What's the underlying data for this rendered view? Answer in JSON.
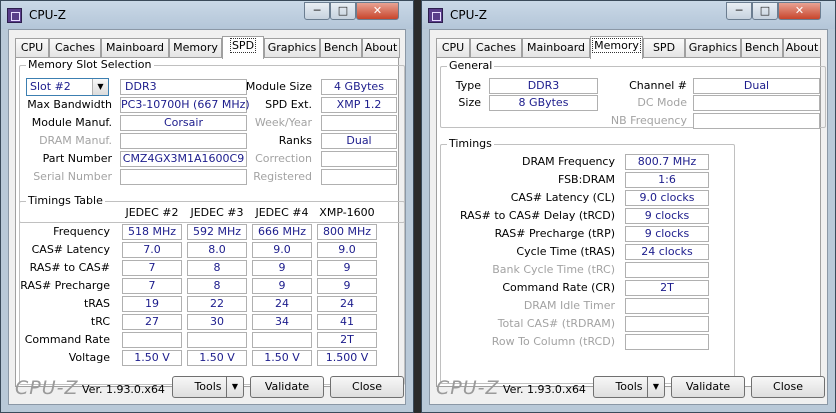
{
  "left": {
    "title": "CPU-Z",
    "tabs": [
      "CPU",
      "Caches",
      "Mainboard",
      "Memory",
      "SPD",
      "Graphics",
      "Bench",
      "About"
    ],
    "active_tab": "SPD",
    "slot_group": "Memory Slot Selection",
    "slot": "Slot #2",
    "type": "DDR3",
    "labels": {
      "max_bw": "Max Bandwidth",
      "manuf": "Module Manuf.",
      "dram_manuf": "DRAM Manuf.",
      "part": "Part Number",
      "serial": "Serial Number",
      "size": "Module Size",
      "spd_ext": "SPD Ext.",
      "week_year": "Week/Year",
      "ranks": "Ranks",
      "correction": "Correction",
      "registered": "Registered"
    },
    "values": {
      "max_bw": "PC3-10700H (667 MHz)",
      "manuf": "Corsair",
      "dram_manuf": "",
      "part": "CMZ4GX3M1A1600C9",
      "serial": "",
      "size": "4 GBytes",
      "spd_ext": "XMP 1.2",
      "week_year": "",
      "ranks": "Dual",
      "correction": "",
      "registered": ""
    },
    "timings_group": "Timings Table",
    "timing_columns": [
      "JEDEC #2",
      "JEDEC #3",
      "JEDEC #4",
      "XMP-1600"
    ],
    "timing_rows": [
      {
        "label": "Frequency",
        "values": [
          "518 MHz",
          "592 MHz",
          "666 MHz",
          "800 MHz"
        ]
      },
      {
        "label": "CAS# Latency",
        "values": [
          "7.0",
          "8.0",
          "9.0",
          "9.0"
        ]
      },
      {
        "label": "RAS# to CAS#",
        "values": [
          "7",
          "8",
          "9",
          "9"
        ]
      },
      {
        "label": "RAS# Precharge",
        "values": [
          "7",
          "8",
          "9",
          "9"
        ]
      },
      {
        "label": "tRAS",
        "values": [
          "19",
          "22",
          "24",
          "24"
        ]
      },
      {
        "label": "tRC",
        "values": [
          "27",
          "30",
          "34",
          "41"
        ]
      },
      {
        "label": "Command Rate",
        "values": [
          "",
          "",
          "",
          "2T"
        ]
      },
      {
        "label": "Voltage",
        "values": [
          "1.50 V",
          "1.50 V",
          "1.50 V",
          "1.500 V"
        ]
      }
    ]
  },
  "right": {
    "title": "CPU-Z",
    "tabs": [
      "CPU",
      "Caches",
      "Mainboard",
      "Memory",
      "SPD",
      "Graphics",
      "Bench",
      "About"
    ],
    "active_tab": "Memory",
    "general_group": "General",
    "labels": {
      "type": "Type",
      "size": "Size",
      "channel": "Channel #",
      "dc_mode": "DC Mode",
      "nb_freq": "NB Frequency"
    },
    "values": {
      "type": "DDR3",
      "size": "8 GBytes",
      "channel": "Dual",
      "dc_mode": "",
      "nb_freq": ""
    },
    "timings_group": "Timings",
    "timing_rows": [
      {
        "label": "DRAM Frequency",
        "value": "800.7 MHz",
        "enabled": true
      },
      {
        "label": "FSB:DRAM",
        "value": "1:6",
        "enabled": true
      },
      {
        "label": "CAS# Latency (CL)",
        "value": "9.0 clocks",
        "enabled": true
      },
      {
        "label": "RAS# to CAS# Delay (tRCD)",
        "value": "9 clocks",
        "enabled": true
      },
      {
        "label": "RAS# Precharge (tRP)",
        "value": "9 clocks",
        "enabled": true
      },
      {
        "label": "Cycle Time (tRAS)",
        "value": "24 clocks",
        "enabled": true
      },
      {
        "label": "Bank Cycle Time (tRC)",
        "value": "",
        "enabled": false
      },
      {
        "label": "Command Rate (CR)",
        "value": "2T",
        "enabled": true
      },
      {
        "label": "DRAM Idle Timer",
        "value": "",
        "enabled": false
      },
      {
        "label": "Total CAS# (tRDRAM)",
        "value": "",
        "enabled": false
      },
      {
        "label": "Row To Column (tRCD)",
        "value": "",
        "enabled": false
      }
    ]
  },
  "footer": {
    "logo": "CPU-Z",
    "version": "Ver. 1.93.0.x64",
    "tools": "Tools",
    "validate": "Validate",
    "close": "Close"
  },
  "window_buttons": {
    "minimize": "─",
    "maximize": "□",
    "close": "✕"
  }
}
